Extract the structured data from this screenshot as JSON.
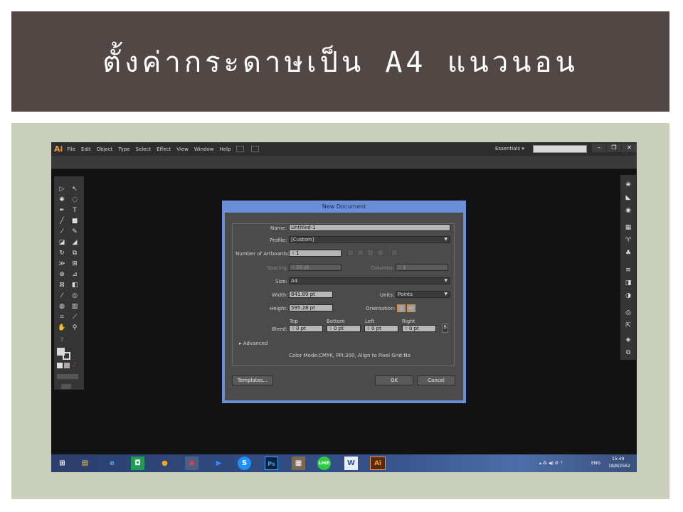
{
  "slide": {
    "title": "ตั้งค่ากระดาษเป็น A4 แนวนอน"
  },
  "app": {
    "logo": "Ai",
    "menu": [
      "File",
      "Edit",
      "Object",
      "Type",
      "Select",
      "Effect",
      "View",
      "Window",
      "Help"
    ],
    "workspace": "Essentials",
    "workspace_caret": "▾",
    "window_controls": [
      "–",
      "❐",
      "✕"
    ]
  },
  "dialog": {
    "title": "New Document",
    "name_label": "Name:",
    "name_value": "Untitled-1",
    "profile_label": "Profile:",
    "profile_value": "[Custom]",
    "artboards_label": "Number of Artboards:",
    "artboards_value": "1",
    "spacing_label": "Spacing:",
    "spacing_value": "20 pt",
    "columns_label": "Columns:",
    "columns_value": "1",
    "size_label": "Size:",
    "size_value": "A4",
    "width_label": "Width:",
    "width_value": "841.89 pt",
    "units_label": "Units:",
    "units_value": "Points",
    "height_label": "Height:",
    "height_value": "595.28 pt",
    "orientation_label": "Orientation:",
    "bleed_label": "Bleed:",
    "bleed_top_label": "Top",
    "bleed_bottom_label": "Bottom",
    "bleed_left_label": "Left",
    "bleed_right_label": "Right",
    "bleed_top": "0 pt",
    "bleed_bottom": "0 pt",
    "bleed_left": "0 pt",
    "bleed_right": "0 pt",
    "advanced_label": "Advanced",
    "info_text": "Color Mode:CMYK, PPI:300, Align to Pixel Grid:No",
    "templates_button": "Templates...",
    "ok_button": "OK",
    "cancel_button": "Cancel"
  },
  "taskbar": {
    "ps_label": "Ps",
    "ai_label": "Ai",
    "skype_label": "S",
    "word_label": "W",
    "language": "ENG",
    "time": "15:49",
    "date": "18/8/2562"
  },
  "colors": {
    "title_bg": "#514745",
    "frame_bg": "#cbd0bc",
    "dialog_border": "#6a8fd8",
    "ai_orange": "#f29a3a"
  }
}
